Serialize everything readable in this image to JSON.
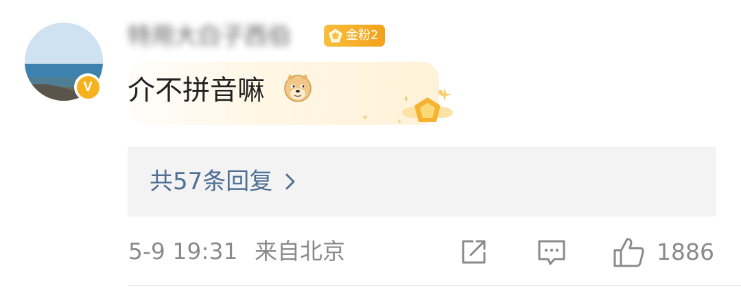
{
  "comment": {
    "username": "特用大白子西伯",
    "verified_badge": "V",
    "fan_badge": {
      "label": "金粉2",
      "icon": "gem-icon",
      "color": "#f5b02d"
    },
    "text": "介不拼音嘛",
    "emoji": "doge-emoji",
    "reply_summary": "共57条回复",
    "timestamp": "5-9 19:31",
    "location": "来自北京",
    "likes": "1886"
  },
  "colors": {
    "link": "#4e6e93",
    "meta": "#8a8a8a",
    "badge": "#f5b02d"
  }
}
